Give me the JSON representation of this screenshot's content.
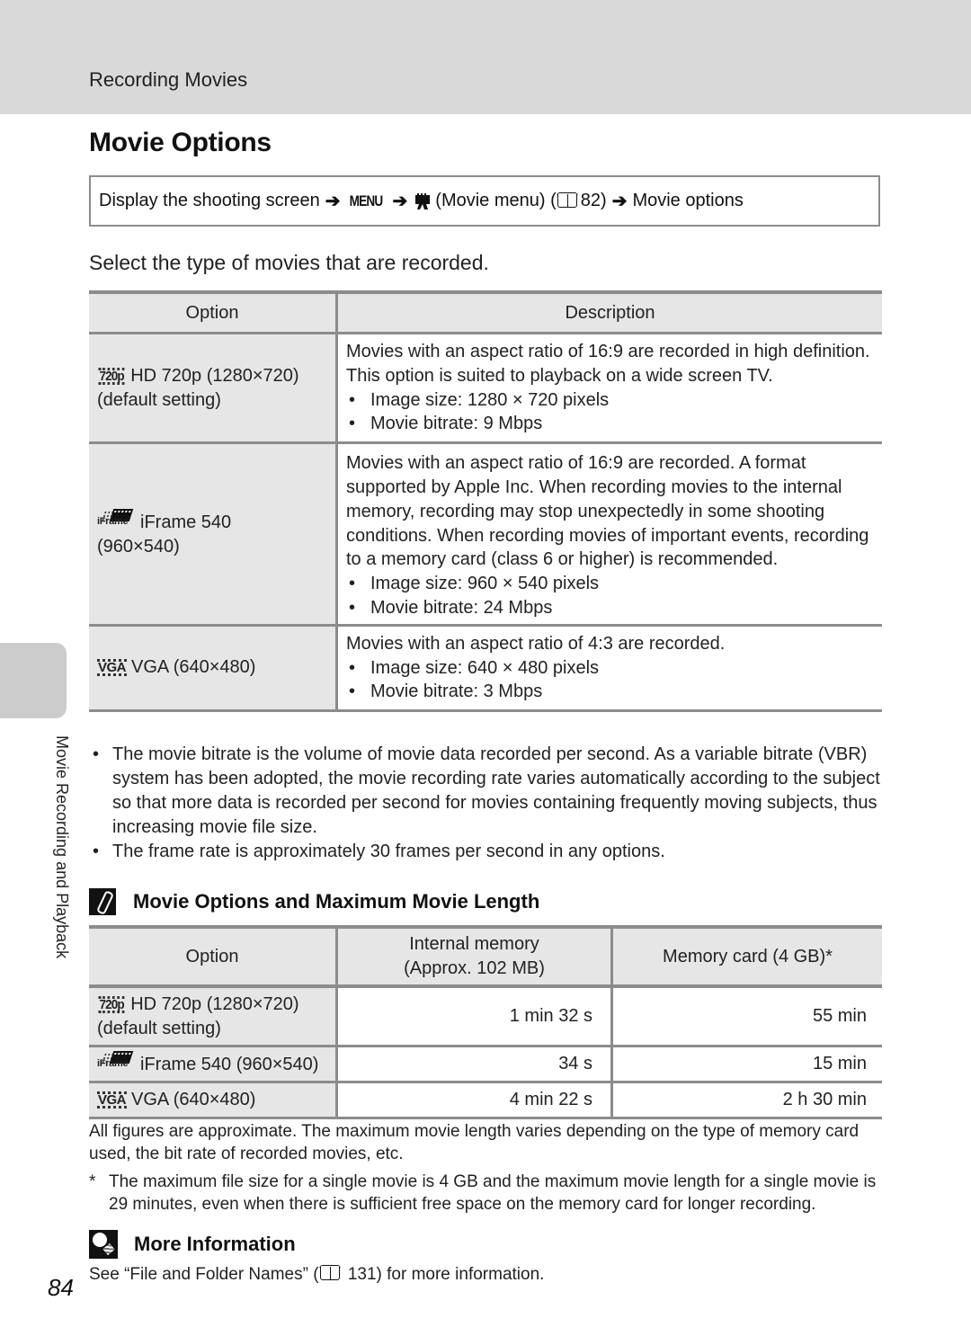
{
  "header": {
    "section": "Recording Movies",
    "title": "Movie Options"
  },
  "nav_path": {
    "step1": "Display the shooting screen",
    "arrow": "➔",
    "menu_button": "MENU",
    "movie_menu_icon": "movie-camera-icon",
    "step3": "(Movie menu) (",
    "ref_icon": "book-reference-icon",
    "ref_page": "82)",
    "step4": "Movie options"
  },
  "intro": "Select the type of movies that are recorded.",
  "options_table": {
    "headers": [
      "Option",
      "Description"
    ],
    "rows": [
      {
        "icon": "720p",
        "option_line1": "HD 720p (1280×720)",
        "option_line2": "(default setting)",
        "description": "Movies with an aspect ratio of 16:9 are recorded in high definition. This option is suited to playback on a wide screen TV.",
        "bullets": [
          "Image size: 1280 × 720 pixels",
          "Movie bitrate: 9 Mbps"
        ]
      },
      {
        "icon": "iFrame",
        "option_line1": "iFrame 540",
        "option_line2": "(960×540)",
        "description": "Movies with an aspect ratio of 16:9 are recorded. A format supported by Apple Inc. When recording movies to the internal memory, recording may stop unexpectedly in some shooting conditions. When recording movies of important events, recording to a memory card (class 6 or higher) is recommended.",
        "bullets": [
          "Image size: 960 × 540 pixels",
          "Movie bitrate: 24 Mbps"
        ]
      },
      {
        "icon": "VGA",
        "option_line1": "VGA (640×480)",
        "option_line2": "",
        "description": "Movies with an aspect ratio of 4:3 are recorded.",
        "bullets": [
          "Image size: 640 × 480 pixels",
          "Movie bitrate: 3 Mbps"
        ]
      }
    ]
  },
  "notes": [
    "The movie bitrate is the volume of movie data recorded per second. As a variable bitrate (VBR) system has been adopted, the movie recording rate varies automatically according to the subject so that more data is recorded per second for movies containing frequently moving subjects, thus increasing movie file size.",
    "The frame rate is approximately 30 frames per second in any options."
  ],
  "side_tab": {
    "label": "Movie Recording and Playback"
  },
  "max_length": {
    "title": "Movie Options and Maximum Movie Length",
    "headers": {
      "option": "Option",
      "internal_line1": "Internal memory",
      "internal_line2": "(Approx. 102 MB)",
      "card": "Memory card (4 GB)*"
    },
    "rows": [
      {
        "icon": "720p",
        "option_line1": "HD 720p (1280×720)",
        "option_line2": "(default setting)",
        "internal": "1 min 32 s",
        "card": "55 min"
      },
      {
        "icon": "iFrame",
        "option_line1": "iFrame 540 (960×540)",
        "internal": "34 s",
        "card": "15 min"
      },
      {
        "icon": "VGA",
        "option_line1": "VGA (640×480)",
        "internal": "4 min 22 s",
        "card": "2 h 30 min"
      }
    ],
    "footnote1": "All figures are approximate. The maximum movie length varies depending on the type of memory card used, the bit rate of recorded movies, etc.",
    "footnote_star": "*",
    "footnote2": "The maximum file size for a single movie is 4 GB and the maximum movie length for a single movie is 29 minutes, even when there is sufficient free space on the memory card for longer recording."
  },
  "more_info": {
    "title": "More Information",
    "text_before": "See “File and Folder Names” (",
    "text_after": " 131) for more information."
  },
  "page_number": "84",
  "bullet_char": "•"
}
